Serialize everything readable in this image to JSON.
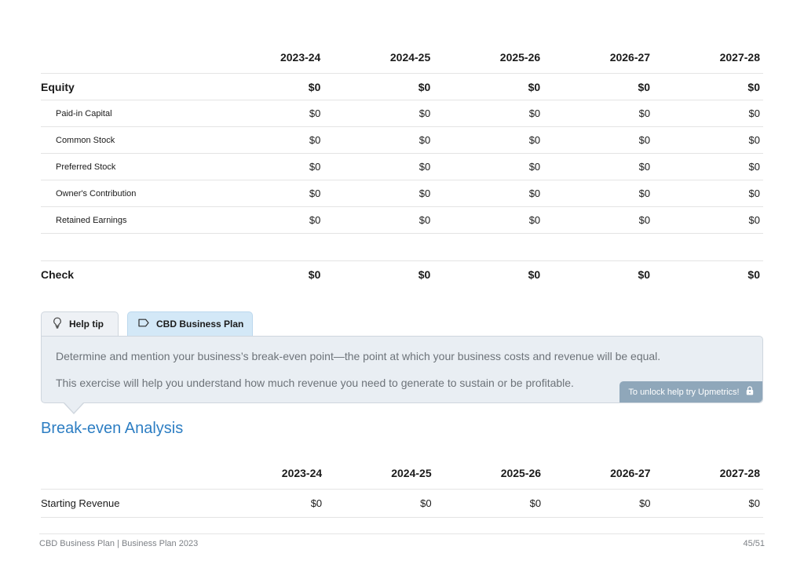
{
  "equity_table": {
    "years": [
      "2023-24",
      "2024-25",
      "2025-26",
      "2026-27",
      "2027-28"
    ],
    "group": {
      "label": "Equity",
      "values": [
        "$0",
        "$0",
        "$0",
        "$0",
        "$0"
      ]
    },
    "rows": [
      {
        "label": "Paid-in Capital",
        "values": [
          "$0",
          "$0",
          "$0",
          "$0",
          "$0"
        ]
      },
      {
        "label": "Common Stock",
        "values": [
          "$0",
          "$0",
          "$0",
          "$0",
          "$0"
        ]
      },
      {
        "label": "Preferred Stock",
        "values": [
          "$0",
          "$0",
          "$0",
          "$0",
          "$0"
        ]
      },
      {
        "label": "Owner's Contribution",
        "values": [
          "$0",
          "$0",
          "$0",
          "$0",
          "$0"
        ]
      },
      {
        "label": "Retained Earnings",
        "values": [
          "$0",
          "$0",
          "$0",
          "$0",
          "$0"
        ]
      }
    ],
    "check": {
      "label": "Check",
      "values": [
        "$0",
        "$0",
        "$0",
        "$0",
        "$0"
      ]
    }
  },
  "tabs": {
    "help_tip": {
      "label": "Help tip",
      "icon": "lightbulb-icon"
    },
    "plan": {
      "label": "CBD Business Plan",
      "icon": "tag-icon"
    }
  },
  "help": {
    "paragraph1": "Determine and mention your business’s break-even point—the point at which your business costs and revenue will be equal.",
    "paragraph2": "This exercise will help you understand how much revenue you need to generate to sustain or be profitable.",
    "unlock_label": "To unlock help try Upmetrics!",
    "unlock_icon": "lock-icon"
  },
  "section_title": "Break-even Analysis",
  "breakeven_table": {
    "years": [
      "2023-24",
      "2024-25",
      "2025-26",
      "2026-27",
      "2027-28"
    ],
    "rows": [
      {
        "label": "Starting Revenue",
        "values": [
          "$0",
          "$0",
          "$0",
          "$0",
          "$0"
        ]
      }
    ]
  },
  "footer": {
    "left": "CBD Business Plan | Business Plan 2023",
    "right": "45/51"
  },
  "colors": {
    "accent": "#2d7ec3",
    "help_bg": "#e9eef3",
    "plan_tab_bg": "#d3e8f7",
    "unlock_bg": "#8fa7ba"
  }
}
